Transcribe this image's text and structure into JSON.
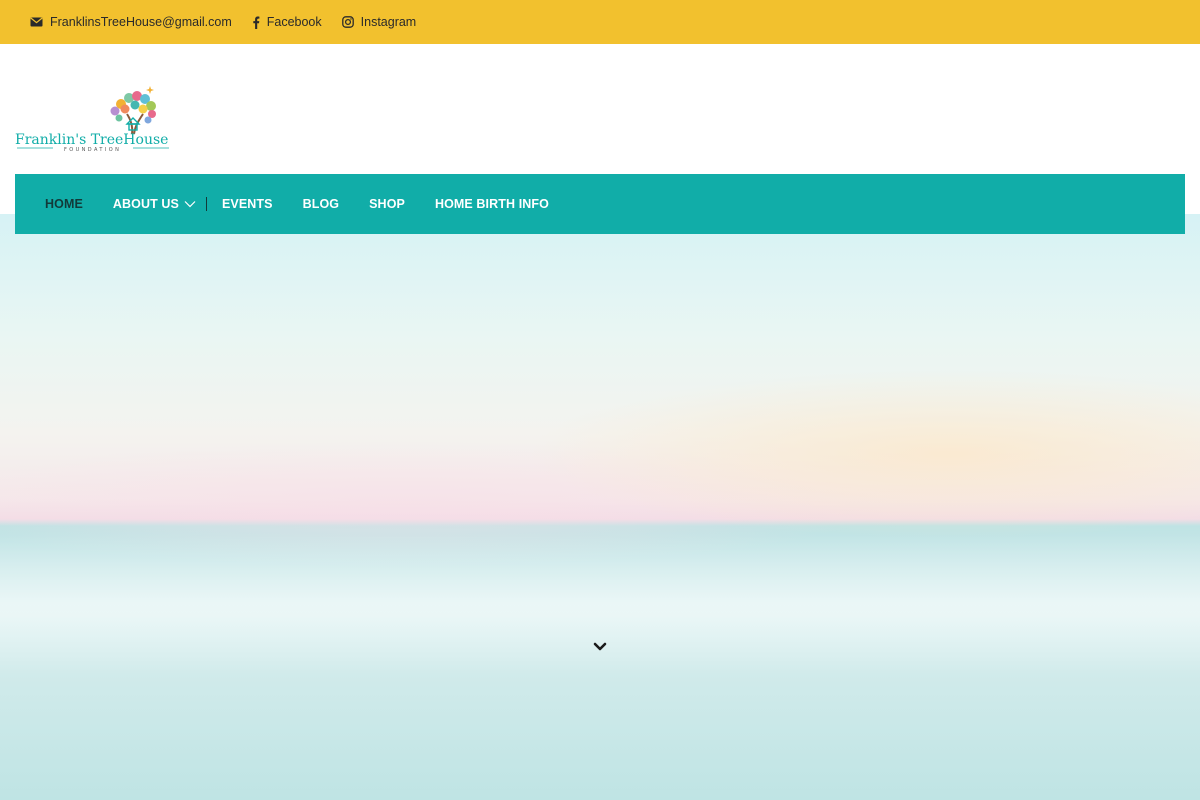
{
  "topbar": {
    "email": {
      "label": "FranklinsTreeHouse@gmail.com",
      "icon": "envelope-icon"
    },
    "facebook": {
      "label": "Facebook",
      "icon": "facebook-icon"
    },
    "instagram": {
      "label": "Instagram",
      "icon": "instagram-icon"
    },
    "background_color": "#f2c12e"
  },
  "logo": {
    "line1": "Franklin's TreeHouse",
    "line2": "FOUNDATION",
    "icon": "tree-house-logo"
  },
  "nav": {
    "background_color": "#11ada8",
    "active_color": "#123a39",
    "items": [
      {
        "label": "HOME",
        "active": true
      },
      {
        "label": "ABOUT US",
        "has_submenu": true
      },
      {
        "label": "EVENTS"
      },
      {
        "label": "BLOG"
      },
      {
        "label": "SHOP"
      },
      {
        "label": "HOME BIRTH INFO"
      }
    ]
  },
  "hero": {
    "scroll_icon": "chevron-down-icon"
  }
}
